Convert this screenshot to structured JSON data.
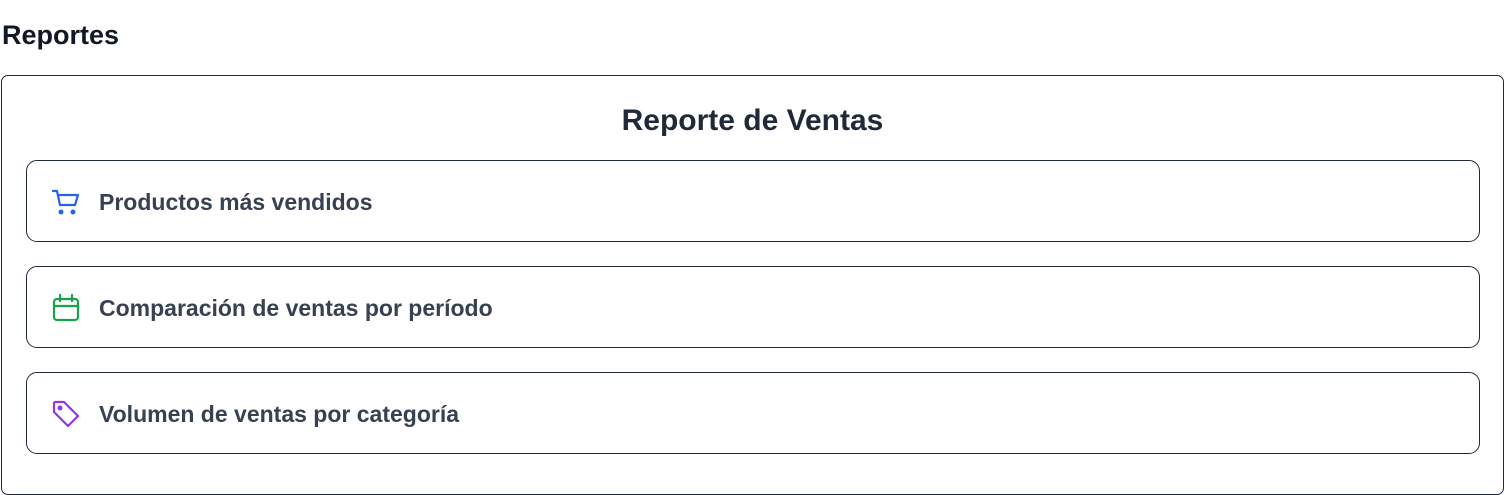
{
  "page": {
    "title": "Reportes"
  },
  "card": {
    "title": "Reporte de Ventas"
  },
  "items": [
    {
      "label": "Productos más vendidos",
      "icon": "shopping-cart-icon",
      "color": "#2563eb"
    },
    {
      "label": "Comparación de ventas por período",
      "icon": "calendar-icon",
      "color": "#16a34a"
    },
    {
      "label": "Volumen de ventas por categoría",
      "icon": "tag-icon",
      "color": "#9333ea"
    }
  ]
}
